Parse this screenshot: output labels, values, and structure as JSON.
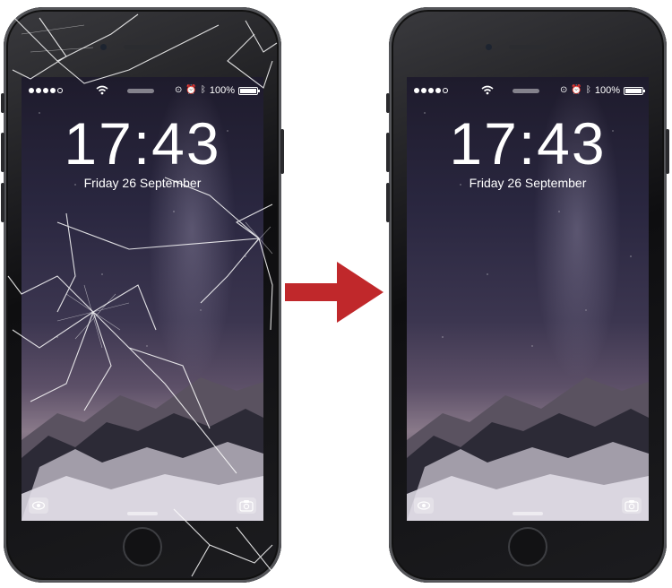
{
  "left_phone": {
    "label": "broken",
    "status_bar": {
      "battery": "100%"
    },
    "clock": "17:43",
    "date": "Friday 26 September"
  },
  "right_phone": {
    "label": "repaired",
    "status_bar": {
      "battery": "100%"
    },
    "clock": "17:43",
    "date": "Friday 26 September"
  },
  "arrow": {
    "color": "#c0282b",
    "direction": "right"
  },
  "icons": [
    "wifi-icon",
    "alarm-icon",
    "bluetooth-icon",
    "battery-icon",
    "eye-icon",
    "camera-icon"
  ]
}
